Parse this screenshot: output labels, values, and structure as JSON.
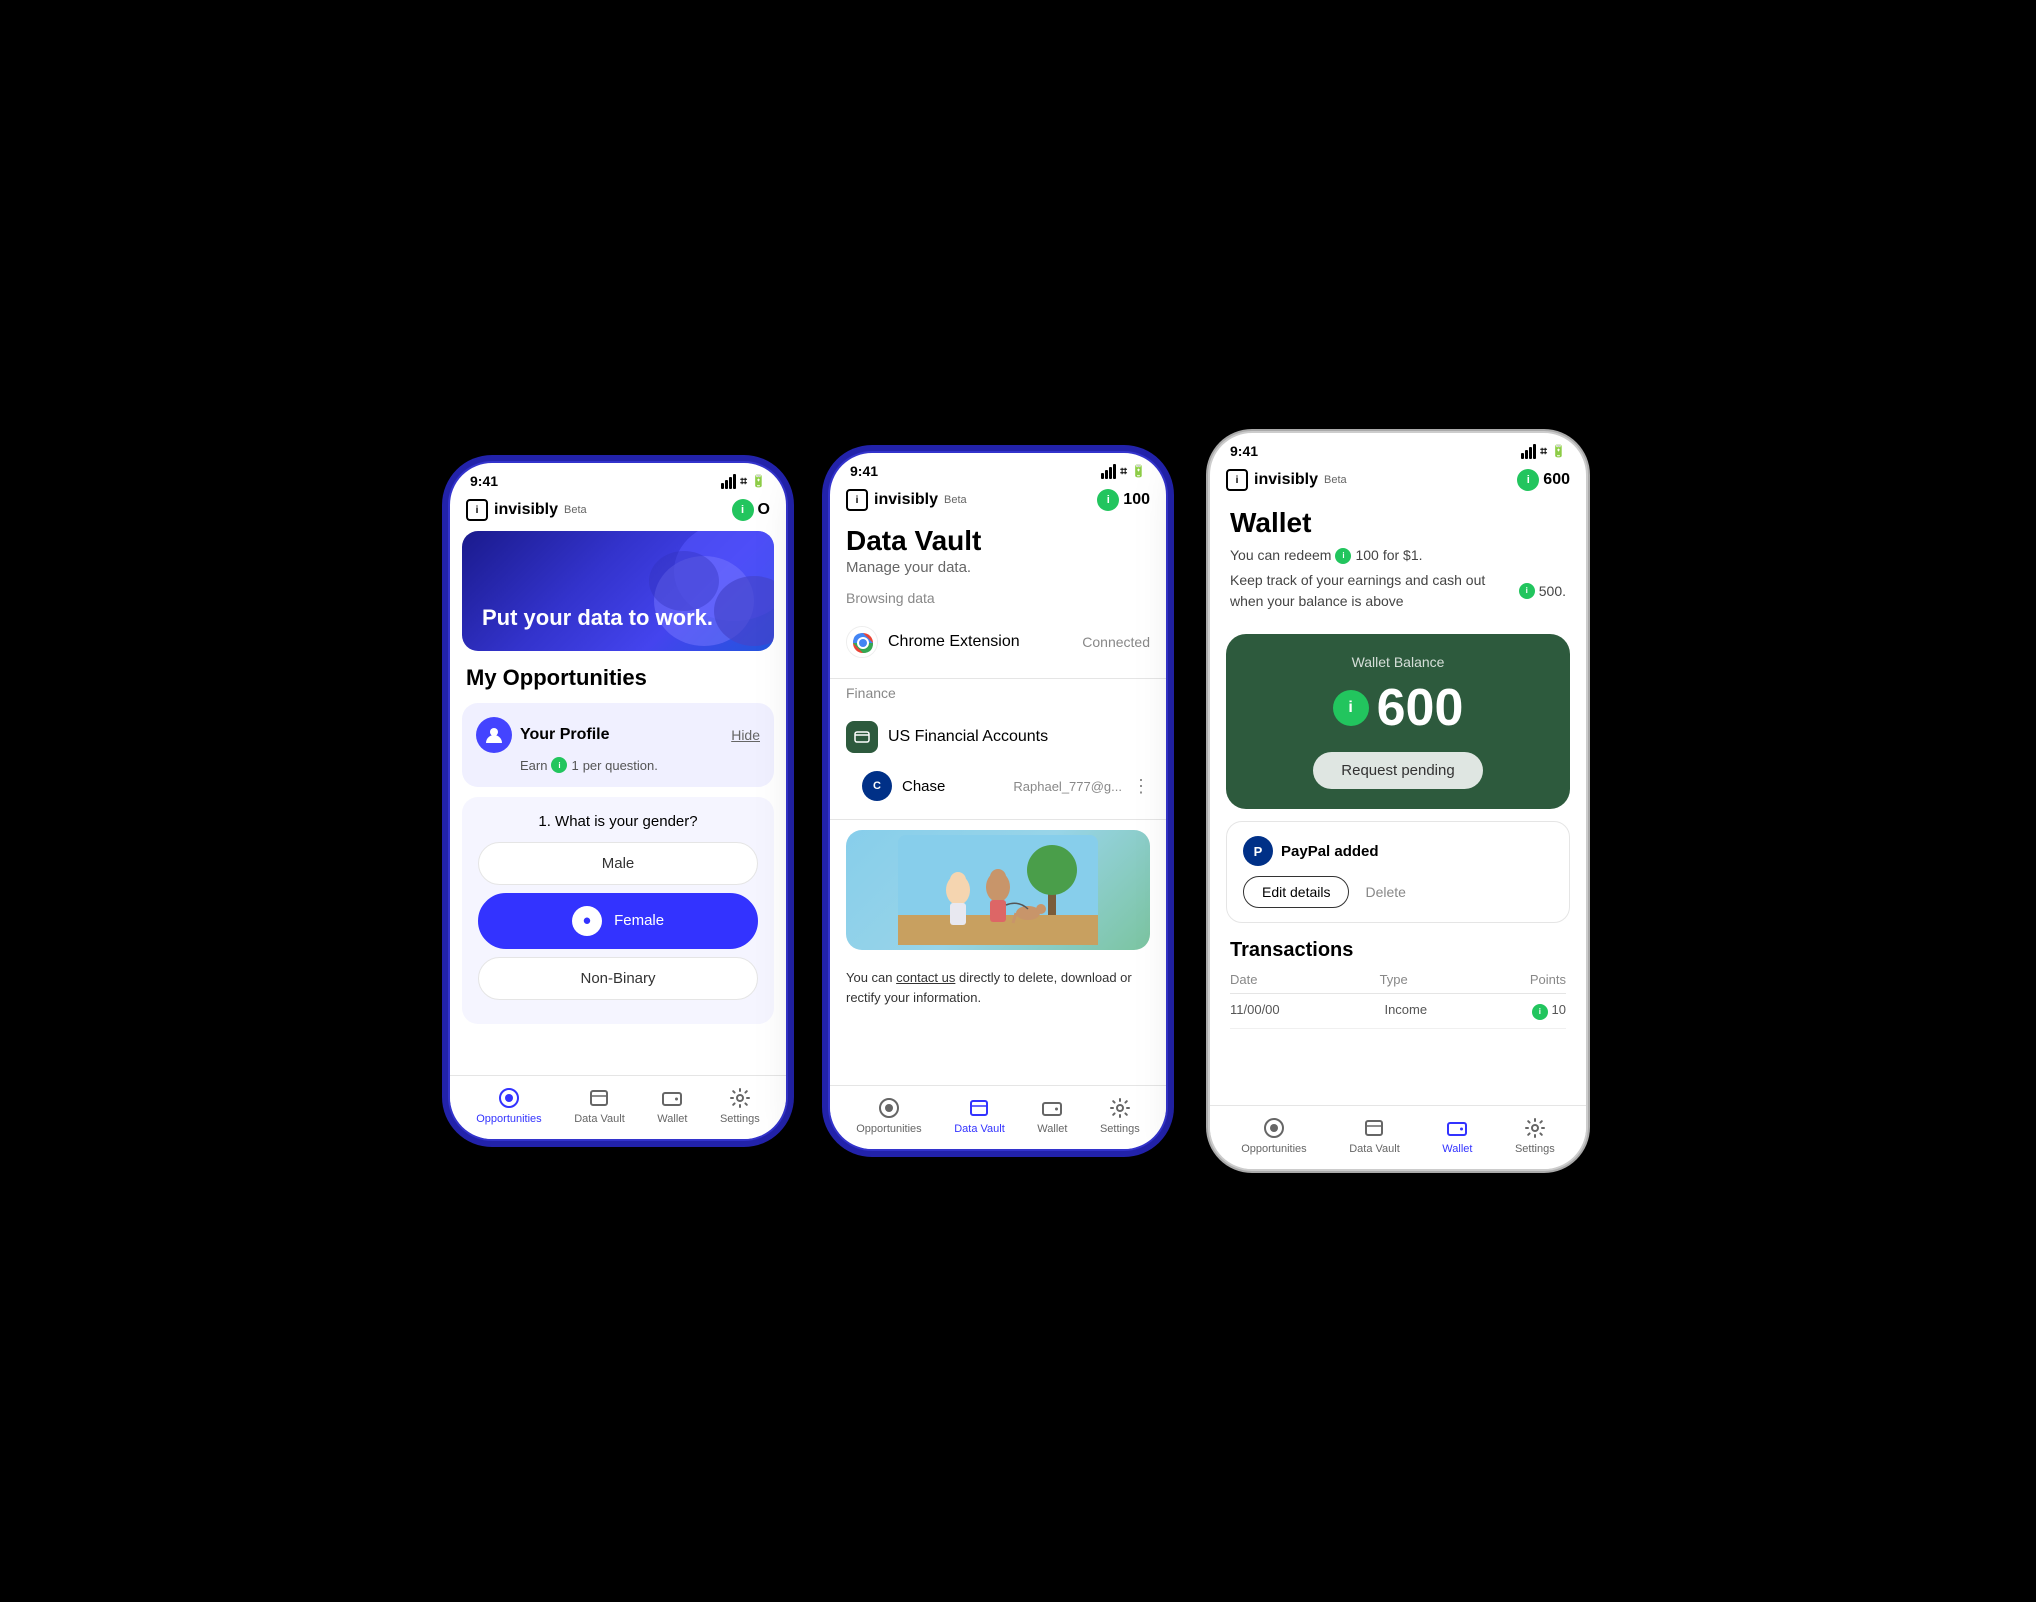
{
  "phone1": {
    "status_time": "9:41",
    "logo": "invisibly",
    "beta": "Beta",
    "points": "O",
    "hero_text": "Put your data to work.",
    "section_title": "My Opportunities",
    "opportunity_name": "Your Profile",
    "hide_label": "Hide",
    "earn_text": "Earn",
    "earn_amount": "1",
    "earn_suffix": "per question.",
    "question": "1. What is your gender?",
    "answers": [
      "Male",
      "Female",
      "Non-Binary"
    ],
    "selected_answer": "Female",
    "nav": {
      "opportunities": "Opportunities",
      "data_vault": "Data Vault",
      "wallet": "Wallet",
      "settings": "Settings"
    }
  },
  "phone2": {
    "status_time": "9:41",
    "logo": "invisibly",
    "beta": "Beta",
    "points": "100",
    "page_title": "Data Vault",
    "page_subtitle": "Manage your data.",
    "browsing_label": "Browsing data",
    "chrome_name": "Chrome Extension",
    "chrome_status": "Connected",
    "finance_label": "Finance",
    "finance_name": "US Financial Accounts",
    "chase_name": "Chase",
    "chase_email": "Raphael_777@g...",
    "contact_text": "You can contact us directly to delete, download or rectify your information.",
    "contact_link": "contact us",
    "nav": {
      "opportunities": "Opportunities",
      "data_vault": "Data Vault",
      "wallet": "Wallet",
      "settings": "Settings"
    }
  },
  "phone3": {
    "status_time": "9:41",
    "logo": "invisibly",
    "beta": "Beta",
    "points": "600",
    "page_title": "Wallet",
    "desc1_pre": "You can redeem",
    "desc1_amount": "100",
    "desc1_post": "for $1.",
    "desc2_pre": "Keep track of your earnings and cash out when your balance is above",
    "desc2_amount": "500.",
    "balance_label": "Wallet Balance",
    "balance_amount": "600",
    "request_btn": "Request pending",
    "paypal_label": "PayPal added",
    "edit_btn": "Edit details",
    "delete_btn": "Delete",
    "transactions_title": "Transactions",
    "tx_col1": "Date",
    "tx_col2": "Type",
    "tx_col3": "Points",
    "tx_date": "11/00/00",
    "tx_type": "Income",
    "tx_points": "10",
    "nav": {
      "opportunities": "Opportunities",
      "data_vault": "Data Vault",
      "wallet": "Wallet",
      "settings": "Settings"
    }
  }
}
